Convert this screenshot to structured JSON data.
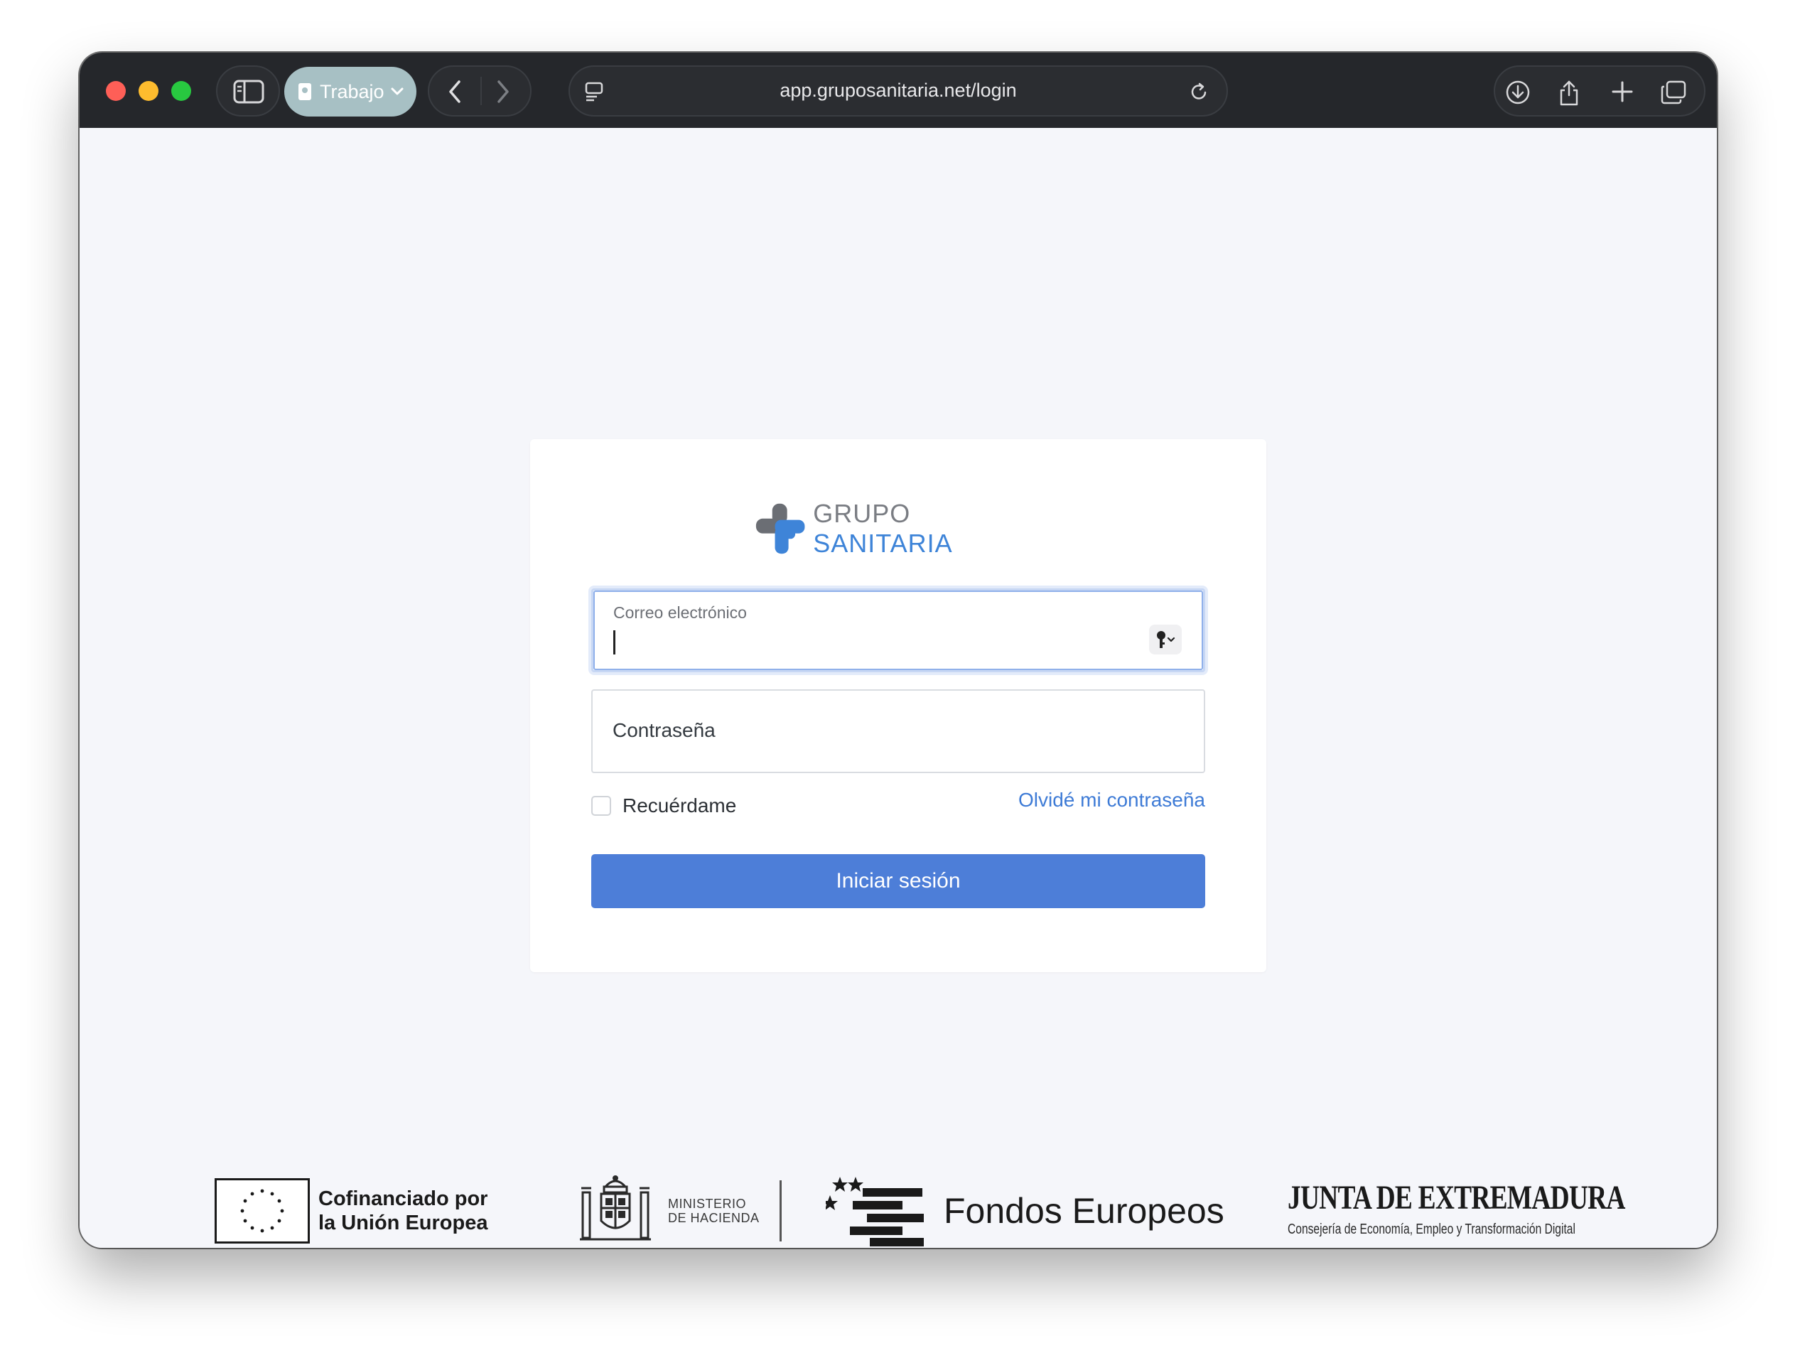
{
  "browser": {
    "profile_label": "Trabajo",
    "url": "app.gruposanitaria.net/login"
  },
  "brand": {
    "name_part1": "GRUPO",
    "name_part2": "SANITARIA",
    "colors": {
      "gray": "#7a7d83",
      "blue": "#3e84d8"
    }
  },
  "login": {
    "email_label": "Correo electrónico",
    "email_value": "",
    "password_placeholder": "Contraseña",
    "remember_label": "Recuérdame",
    "remember_checked": false,
    "forgot_link": "Olvidé mi contraseña",
    "submit_label": "Iniciar sesión",
    "accent_color": "#4d7ed8"
  },
  "footer": {
    "eu_line1": "Cofinanciado por",
    "eu_line2": "la Unión Europea",
    "ministerio_line1": "MINISTERIO",
    "ministerio_line2": "DE HACIENDA",
    "fondos": "Fondos Europeos",
    "junta_title": "JUNTA DE EXTREMADURA",
    "junta_sub": "Consejería de Economía, Empleo y Transformación Digital"
  }
}
